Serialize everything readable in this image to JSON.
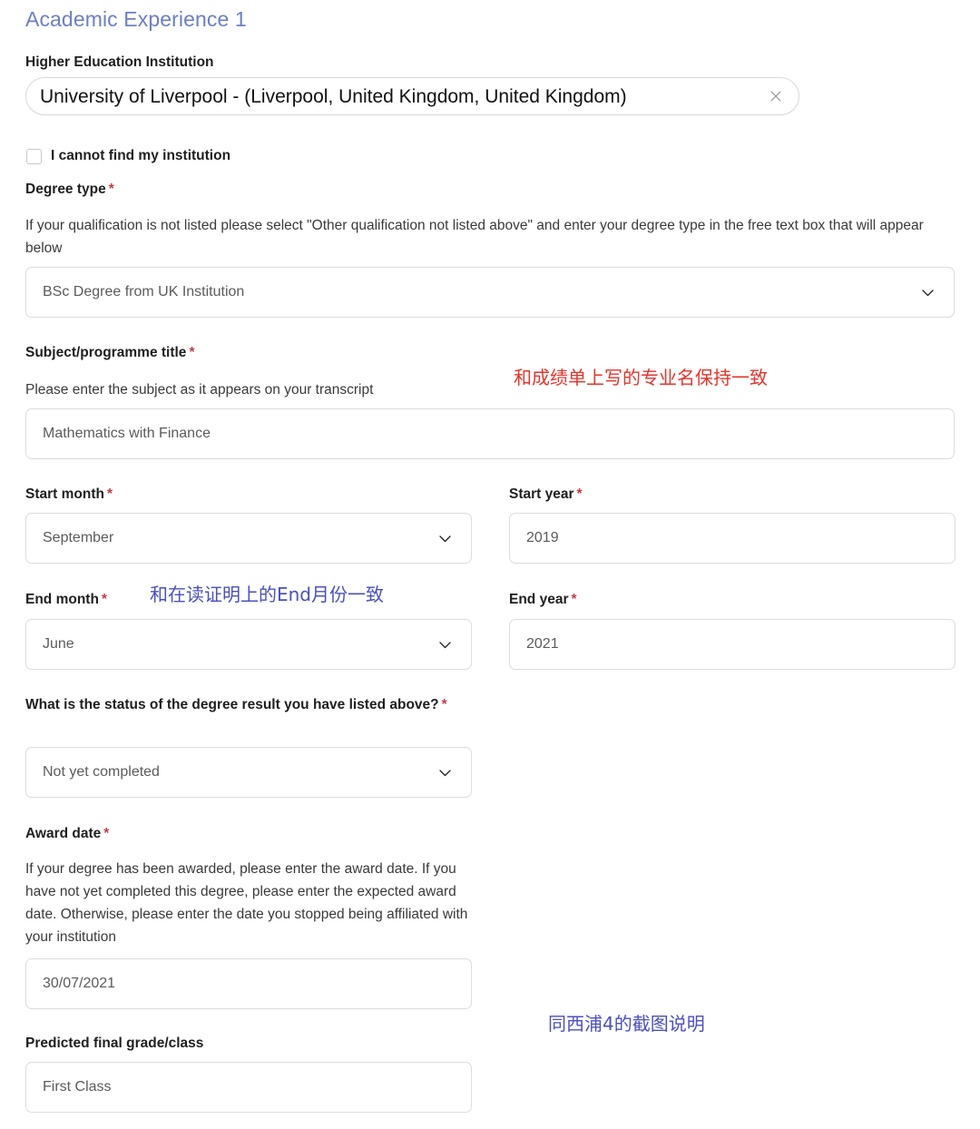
{
  "heading": "Academic Experience 1",
  "institution": {
    "label": "Higher Education Institution",
    "value": "University of Liverpool - (Liverpool, United Kingdom, United Kingdom)",
    "clear_icon": "close-icon"
  },
  "cannot_find": {
    "label": "I cannot find my institution",
    "checked": false
  },
  "degree_type": {
    "label": "Degree type",
    "required": "*",
    "help": "If your qualification is not listed please select \"Other qualification not listed above\" and enter your degree type in the free text box that will appear below",
    "value": "BSc Degree from UK Institution"
  },
  "subject": {
    "label": "Subject/programme title",
    "required": "*",
    "help": "Please enter the subject as it appears on your transcript",
    "value": "Mathematics with Finance"
  },
  "start_month": {
    "label": "Start month",
    "required": "*",
    "value": "September"
  },
  "start_year": {
    "label": "Start year",
    "required": "*",
    "value": "2019"
  },
  "end_month": {
    "label": "End month",
    "required": "*",
    "value": "June"
  },
  "end_year": {
    "label": "End year",
    "required": "*",
    "value": "2021"
  },
  "degree_status": {
    "label": "What is the status of the degree result you have listed above?",
    "required": "*",
    "value": "Not yet completed"
  },
  "award_date": {
    "label": "Award date",
    "required": "*",
    "help": "If your degree has been awarded, please enter the award date. If you have not yet completed this degree, please enter the expected award date. Otherwise, please enter the date you stopped being affiliated with your institution",
    "value": "30/07/2021"
  },
  "predicted_grade": {
    "label": "Predicted final grade/class",
    "value": "First Class"
  },
  "annotations": {
    "subject_note": "和成绩单上写的专业名保持一致",
    "end_month_note": "和在读证明上的End月份一致",
    "grade_note": "同西浦4的截图说明"
  },
  "colors": {
    "heading": "#6b7fc7",
    "required_star": "#c8394a",
    "annotation_red": "#e8332a",
    "annotation_blue": "#4a4fc4",
    "field_border": "#dcdcdc"
  }
}
